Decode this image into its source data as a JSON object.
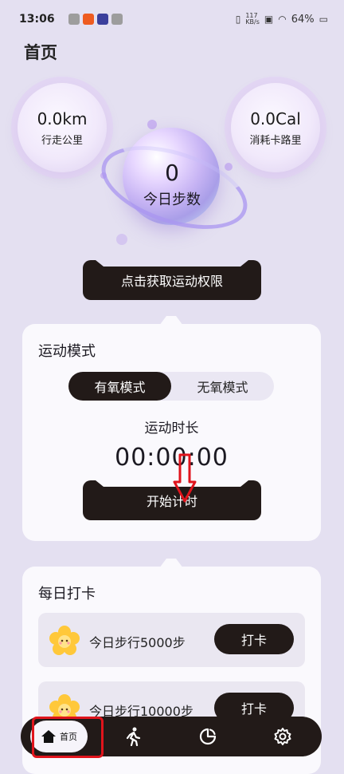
{
  "status_bar": {
    "time": "13:06",
    "network_speed": "117\nKB/s",
    "battery": "64%"
  },
  "header": {
    "title": "首页"
  },
  "metrics": {
    "distance": {
      "value": "0.0km",
      "label": "行走公里"
    },
    "calories": {
      "value": "0.0Cal",
      "label": "消耗卡路里"
    },
    "steps": {
      "value": "0",
      "label": "今日步数"
    }
  },
  "permission_button": {
    "label": "点击获取运动权限"
  },
  "exercise_mode": {
    "title": "运动模式",
    "modes": [
      {
        "label": "有氧模式",
        "active": true
      },
      {
        "label": "无氧模式",
        "active": false
      }
    ],
    "duration_label": "运动时长",
    "timer": "00:00:00",
    "start_label": "开始计时"
  },
  "daily_checkin": {
    "title": "每日打卡",
    "tasks": [
      {
        "label": "今日步行5000步",
        "button": "打卡"
      },
      {
        "label": "今日步行10000步",
        "button": "打卡"
      }
    ]
  },
  "tab_bar": {
    "items": [
      {
        "label": "首页",
        "icon": "home-icon",
        "active": true
      },
      {
        "label": "",
        "icon": "walk-icon"
      },
      {
        "label": "",
        "icon": "chart-icon"
      },
      {
        "label": "",
        "icon": "settings-icon"
      }
    ]
  },
  "colors": {
    "background": "#e4e0f1",
    "dark": "#221a18",
    "card": "#faf9fd",
    "annotation": "#e0141c"
  }
}
